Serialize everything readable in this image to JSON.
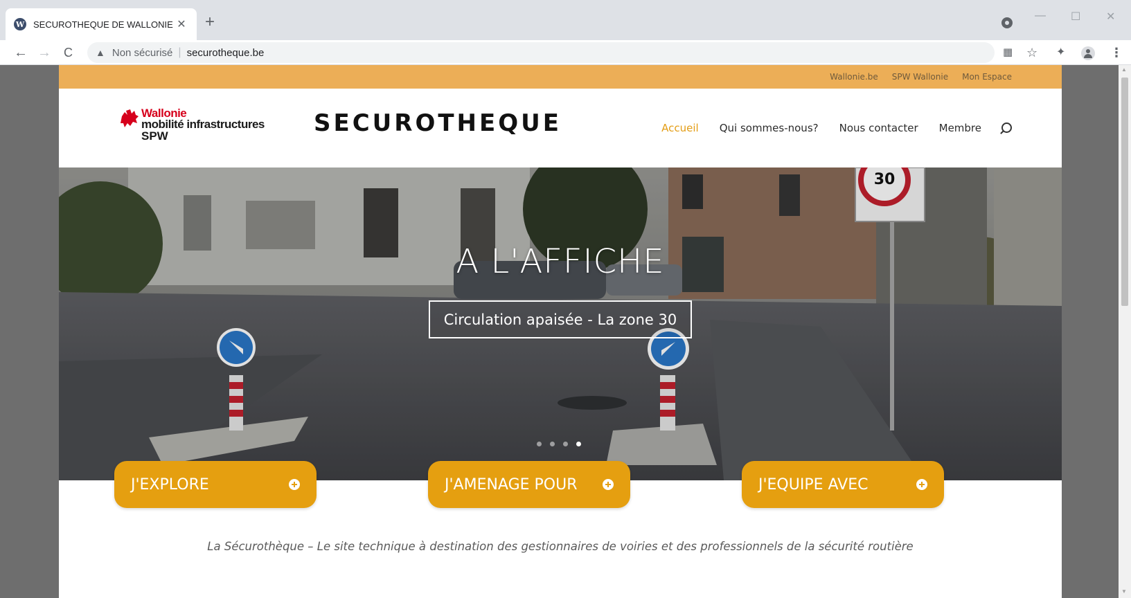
{
  "browser": {
    "tab_title": "SECUROTHEQUE DE WALLONIE",
    "tab_close": "✕",
    "new_tab": "+",
    "window_controls": {
      "minimize": "—",
      "maximize": "☐",
      "close": "✕"
    },
    "nav": {
      "back": "←",
      "forward": "→",
      "reload": "C"
    },
    "address": {
      "security_label": "Non sécurisé",
      "separator": "|",
      "url": "securotheque.be"
    },
    "toolbar_icons": [
      "qr-code-icon",
      "star-icon",
      "extensions-icon",
      "profile-icon",
      "menu-icon"
    ]
  },
  "topbar": {
    "links": [
      "Wallonie.be",
      "SPW Wallonie",
      "Mon Espace"
    ]
  },
  "logo": {
    "line1": "Wallonie",
    "line2": "mobilité infrastructures",
    "line3": "SPW"
  },
  "brand": "SECUROTHEQUE",
  "menu": {
    "items": [
      "Accueil",
      "Qui sommes-nous?",
      "Nous contacter",
      "Membre"
    ],
    "active": "Accueil"
  },
  "hero": {
    "heading": "A L'AFFICHE",
    "button": "Circulation apaisée - La zone 30",
    "sign_number": "30",
    "slides": 4,
    "active_slide": 4
  },
  "cta": {
    "explore": "J'EXPLORE",
    "amenage": "J'AMENAGE POUR",
    "equipe": "J'EQUIPE AVEC"
  },
  "tagline": "La Sécurothèque – Le site technique à destination des gestionnaires de voiries et des professionnels de la sécurité routière",
  "colors": {
    "topbar": "#ecae57",
    "accent": "#e59f10",
    "active_menu": "#e39d15",
    "wallonie_red": "#d6001c"
  }
}
